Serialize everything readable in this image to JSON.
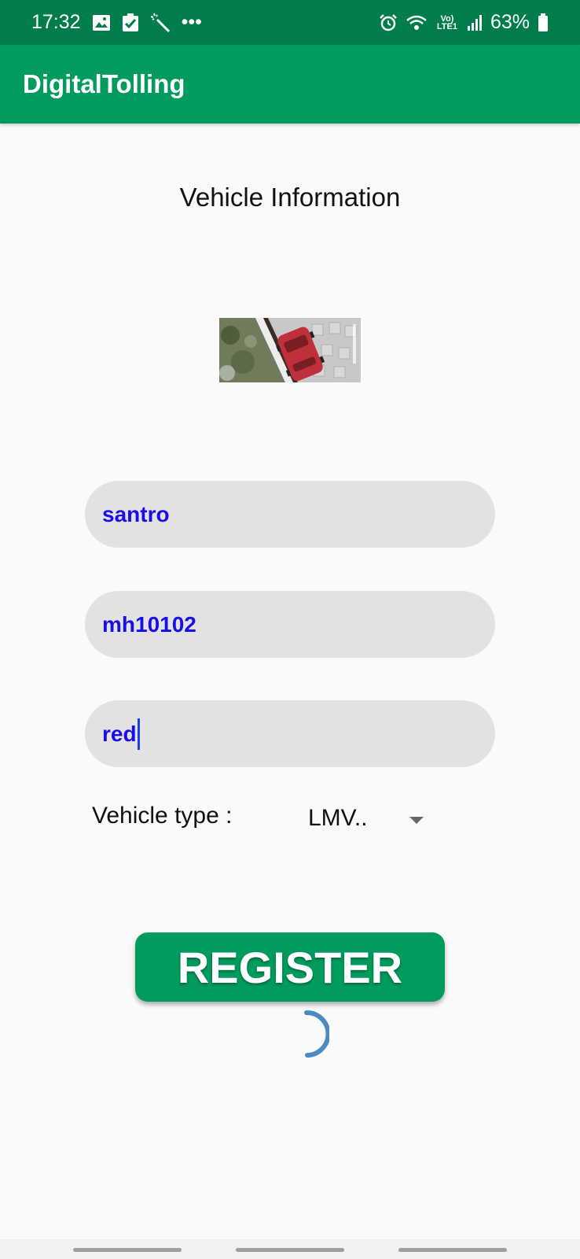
{
  "status_bar": {
    "time": "17:32",
    "network_text": "Vo) LTE1",
    "battery_percent": "63%",
    "overflow": "•••",
    "icons": [
      "image-icon",
      "checklist-icon",
      "magic-wand-icon",
      "alarm-icon",
      "wifi-icon",
      "signal-icon",
      "battery-icon"
    ]
  },
  "app_bar": {
    "title": "DigitalTolling"
  },
  "main": {
    "title": "Vehicle Information",
    "photo": "vehicle-photo",
    "fields": [
      {
        "value": "santro"
      },
      {
        "value": "mh10102"
      },
      {
        "value": "red"
      }
    ],
    "vehicle_type": {
      "label": "Vehicle type :",
      "selected": "LMV.."
    },
    "register_label": "REGISTER"
  },
  "colors": {
    "status_bar": "#007d4a",
    "app_bar": "#009b5d",
    "field_bg": "#e2e2e2",
    "field_text": "#1a0ee8",
    "progress": "#4a8bc2"
  }
}
